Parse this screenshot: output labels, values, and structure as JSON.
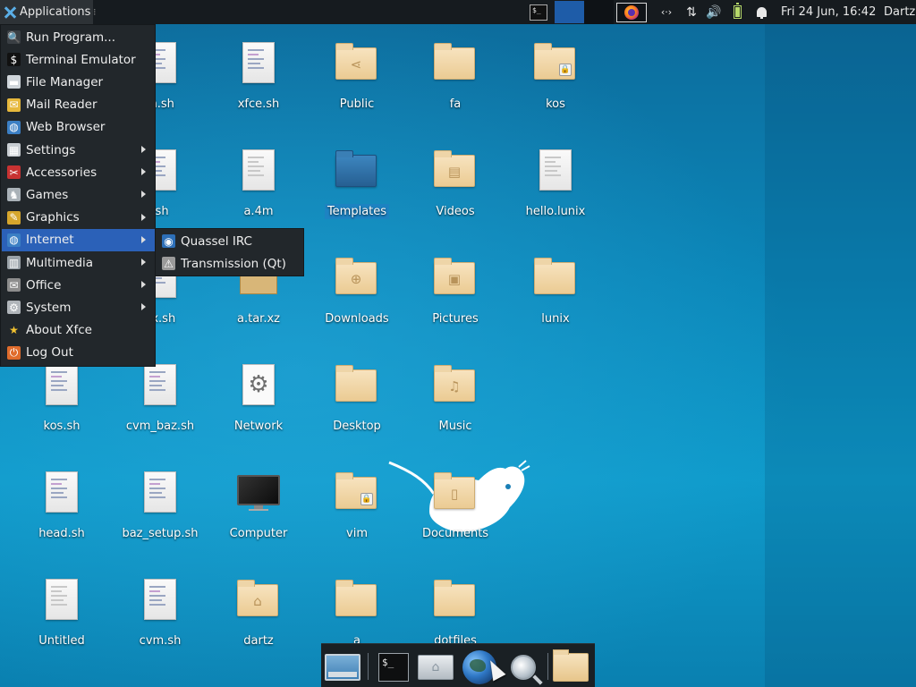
{
  "panel": {
    "applications_label": "Applications",
    "handle": "⁝",
    "terminal_icon_text": "$_",
    "clock": "Fri 24 Jun, 16:42",
    "username": "Dartz",
    "network_icon_text": "‹·›",
    "updown_icon_text": "⇅",
    "volume_icon_text": "🔊",
    "battery_level": 1.0,
    "accent_color": "#2b61b8"
  },
  "menu": {
    "items": [
      {
        "label": "Run Program...",
        "icon": "search-icon",
        "submenu": false
      },
      {
        "label": "Terminal Emulator",
        "icon": "terminal-icon",
        "submenu": false
      },
      {
        "label": "File Manager",
        "icon": "folder-icon",
        "submenu": false
      },
      {
        "label": "Mail Reader",
        "icon": "mail-icon",
        "submenu": false
      },
      {
        "label": "Web Browser",
        "icon": "globe-icon",
        "submenu": false
      },
      {
        "label": "Settings",
        "icon": "settings-icon",
        "submenu": true
      },
      {
        "label": "Accessories",
        "icon": "accessories-icon",
        "submenu": true
      },
      {
        "label": "Games",
        "icon": "games-icon",
        "submenu": true
      },
      {
        "label": "Graphics",
        "icon": "graphics-icon",
        "submenu": true
      },
      {
        "label": "Internet",
        "icon": "internet-icon",
        "submenu": true,
        "active": true
      },
      {
        "label": "Multimedia",
        "icon": "multimedia-icon",
        "submenu": true
      },
      {
        "label": "Office",
        "icon": "office-icon",
        "submenu": true
      },
      {
        "label": "System",
        "icon": "system-icon",
        "submenu": true
      },
      {
        "label": "About Xfce",
        "icon": "star-icon",
        "submenu": false
      },
      {
        "label": "Log Out",
        "icon": "logout-icon",
        "submenu": false
      }
    ]
  },
  "submenu_internet": {
    "items": [
      {
        "label": "Quassel IRC",
        "icon": "quassel-icon"
      },
      {
        "label": "Transmission (Qt)",
        "icon": "transmission-icon"
      }
    ]
  },
  "desktop": {
    "icons": [
      {
        "label": "m.sh",
        "type": "script"
      },
      {
        "label": "xfce.sh",
        "type": "script"
      },
      {
        "label": "Public",
        "type": "folder",
        "emblem": "share-icon"
      },
      {
        "label": "fa",
        "type": "folder"
      },
      {
        "label": "kos",
        "type": "folder",
        "locked": true
      },
      {
        "label": ".sh",
        "type": "script"
      },
      {
        "label": "a.4m",
        "type": "document"
      },
      {
        "label": "Templates",
        "type": "folder",
        "selected": true
      },
      {
        "label": "Videos",
        "type": "folder",
        "emblem": "film-icon"
      },
      {
        "label": "hello.lunix",
        "type": "document"
      },
      {
        "label": "ox.sh",
        "type": "script"
      },
      {
        "label": "a.tar.xz",
        "type": "archive"
      },
      {
        "label": "Downloads",
        "type": "folder",
        "emblem": "download-icon"
      },
      {
        "label": "Pictures",
        "type": "folder",
        "emblem": "picture-icon"
      },
      {
        "label": "lunix",
        "type": "folder"
      },
      {
        "label": "kos.sh",
        "type": "script"
      },
      {
        "label": "cvm_baz.sh",
        "type": "script"
      },
      {
        "label": "Network",
        "type": "network"
      },
      {
        "label": "Desktop",
        "type": "folder"
      },
      {
        "label": "Music",
        "type": "folder",
        "emblem": "music-icon"
      },
      {
        "label": "head.sh",
        "type": "script"
      },
      {
        "label": "baz_setup.sh",
        "type": "script"
      },
      {
        "label": "Computer",
        "type": "computer"
      },
      {
        "label": "vim",
        "type": "folder",
        "locked": true
      },
      {
        "label": "Documents",
        "type": "folder",
        "emblem": "document-icon"
      },
      {
        "label": "Untitled",
        "type": "document"
      },
      {
        "label": "cvm.sh",
        "type": "script"
      },
      {
        "label": "dartz",
        "type": "folder",
        "emblem": "home-icon"
      },
      {
        "label": "a",
        "type": "folder"
      },
      {
        "label": "dotfiles",
        "type": "folder"
      }
    ]
  },
  "dock": {
    "terminal_text": "$_",
    "items": [
      "show-desktop-icon",
      "terminal-icon",
      "home-folder-icon",
      "web-browser-icon",
      "search-icon",
      "folder-icon"
    ]
  }
}
